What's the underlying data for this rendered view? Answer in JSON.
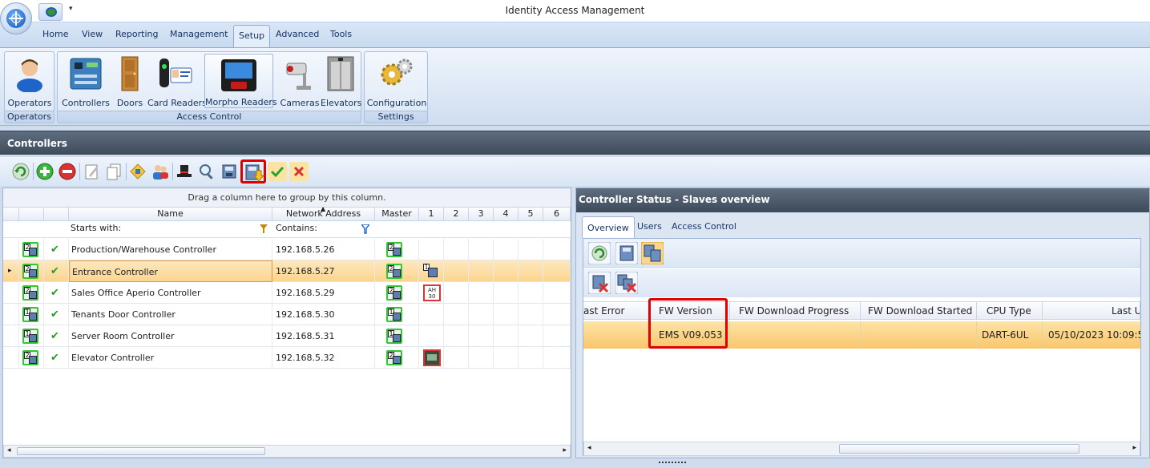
{
  "window": {
    "title": "Identity Access Management"
  },
  "ribbon_tabs": [
    "Home",
    "View",
    "Reporting",
    "Management",
    "Setup",
    "Advanced",
    "Tools"
  ],
  "active_tab": "Setup",
  "ribbon": {
    "groups": [
      {
        "caption": "Operators",
        "buttons": [
          "Operators"
        ]
      },
      {
        "caption": "Access Control",
        "buttons": [
          "Controllers",
          "Doors",
          "Card Readers",
          "Morpho Readers",
          "Cameras",
          "Elevators"
        ]
      },
      {
        "caption": "Settings",
        "buttons": [
          "Configuration"
        ]
      }
    ]
  },
  "section": {
    "title": "Controllers"
  },
  "grid": {
    "group_hint": "Drag a column here to group by this column.",
    "columns": [
      "Name",
      "Network Address",
      "Master",
      "1",
      "2",
      "3",
      "4",
      "5",
      "6"
    ],
    "filter": {
      "name_mode": "Starts with:",
      "address_mode": "Contains:"
    },
    "rows": [
      {
        "master_no": "2",
        "name": "Production/Warehouse Controller",
        "address": "192.168.5.26",
        "slave1": ""
      },
      {
        "master_no": "2",
        "name": "Entrance Controller",
        "address": "192.168.5.27",
        "slave1": "reader",
        "selected": true,
        "slave1_no": "1"
      },
      {
        "master_no": "2",
        "name": "Sales Office Aperio Controller",
        "address": "192.168.5.29",
        "slave1": "aperio",
        "slave1_text": "AH\n30"
      },
      {
        "master_no": "1",
        "name": "Tenants Door Controller",
        "address": "192.168.5.30",
        "slave1": ""
      },
      {
        "master_no": "1",
        "name": "Server Room Controller",
        "address": "192.168.5.31",
        "slave1": ""
      },
      {
        "master_no": "2",
        "name": "Elevator Controller",
        "address": "192.168.5.32",
        "slave1": "elevator"
      }
    ]
  },
  "status_panel": {
    "title": "Controller Status - Slaves overview",
    "tabs": [
      "Overview",
      "Users",
      "Access Control"
    ],
    "active_tab": "Overview",
    "columns": [
      "ast Error",
      "FW Version",
      "FW Download Progress",
      "FW Download Started",
      "CPU Type",
      "Last U"
    ],
    "row": {
      "last_error": "",
      "fw_version": "EMS V09.053",
      "fw_progress": "",
      "fw_started": "",
      "cpu_type": "DART-6UL",
      "last_update": "05/10/2023 10:09:5"
    }
  },
  "colors": {
    "header_dark": "#4a5769",
    "selected_row": "#fbd58e",
    "highlight_red": "#e00000",
    "ok_green": "#1fa01f"
  }
}
